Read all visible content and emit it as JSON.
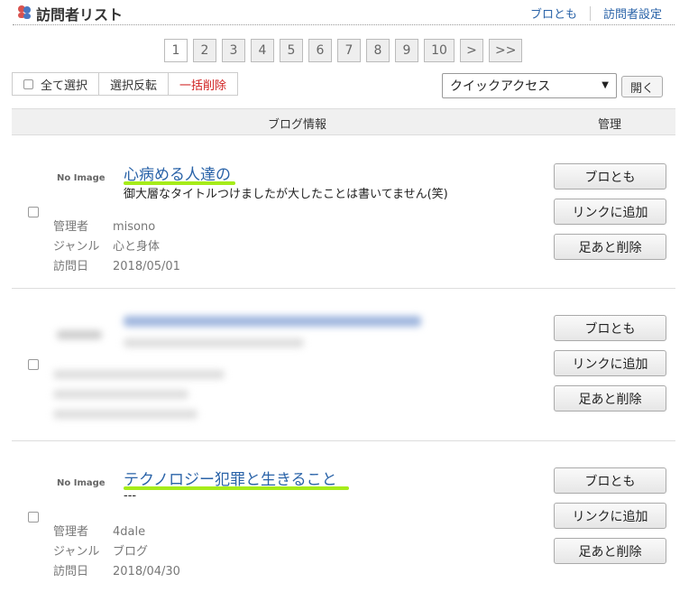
{
  "header": {
    "title": "訪問者リスト",
    "links": [
      "ブロとも",
      "訪問者設定"
    ]
  },
  "pager": [
    "1",
    "2",
    "3",
    "4",
    "5",
    "6",
    "7",
    "8",
    "9",
    "10",
    ">",
    ">>"
  ],
  "pager_current": "1",
  "toolbar": {
    "select_all": "全て選択",
    "invert": "選択反転",
    "bulk_delete": "一括削除"
  },
  "quick_access": {
    "selected": "クイックアクセス",
    "open_button": "開く"
  },
  "table": {
    "col_info": "ブログ情報",
    "col_manage": "管理"
  },
  "rows": [
    {
      "no_image": "No Image",
      "title": "心病める人達の",
      "description": "御大層なタイトルつけましたが大したことは書いてません(笑)",
      "admin_label": "管理者",
      "admin": "misono",
      "genre_label": "ジャンル",
      "genre": "心と身体",
      "visit_label": "訪問日",
      "visit_date": "2018/05/01",
      "buttons": [
        "ブロとも",
        "リンクに追加",
        "足あと削除"
      ]
    },
    {
      "buttons": [
        "ブロとも",
        "リンクに追加",
        "足あと削除"
      ]
    },
    {
      "no_image": "No Image",
      "title": "テクノロジー犯罪と生きること",
      "description": "---",
      "admin_label": "管理者",
      "admin": "4dale",
      "genre_label": "ジャンル",
      "genre": "ブログ",
      "visit_label": "訪問日",
      "visit_date": "2018/04/30",
      "buttons": [
        "ブロとも",
        "リンクに追加",
        "足あと削除"
      ]
    }
  ],
  "colors": {
    "link": "#2a63a8",
    "highlight": "#a6ec1a",
    "delete": "#d02020"
  }
}
